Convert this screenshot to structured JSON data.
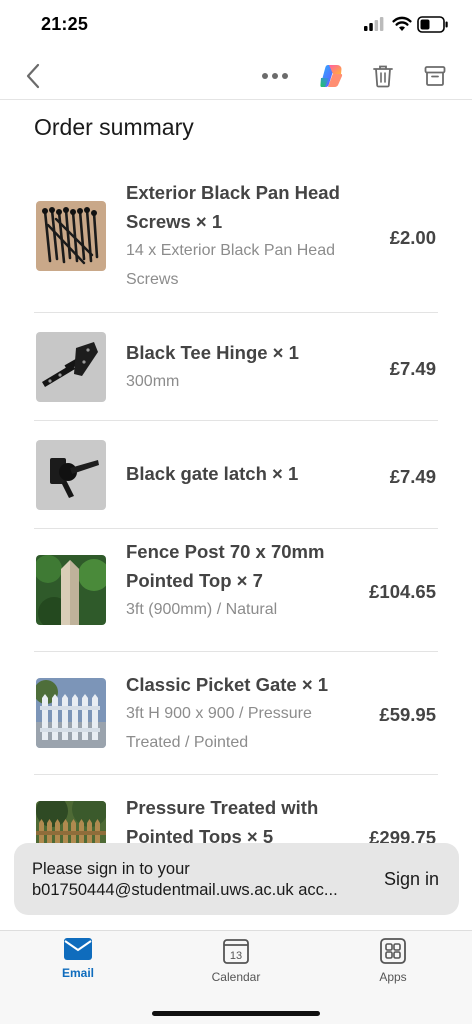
{
  "status_bar": {
    "time": "21:25"
  },
  "nav": {
    "icons": [
      "chevron-left-icon",
      "more-horizontal-icon",
      "copilot-icon",
      "trash-icon",
      "archive-icon"
    ]
  },
  "summary": {
    "title": "Order summary",
    "items": [
      {
        "name": "Exterior Black Pan Head Screws × 1",
        "desc": "14 x Exterior Black Pan Head Screws",
        "price": "£2.00",
        "thumb": "screws"
      },
      {
        "name": "Black Tee Hinge × 1",
        "desc": "300mm",
        "price": "£7.49",
        "thumb": "hinge"
      },
      {
        "name": "Black gate latch × 1",
        "desc": "",
        "price": "£7.49",
        "thumb": "latch"
      },
      {
        "name": "Fence Post 70 x 70mm Pointed Top × 7",
        "desc": "3ft (900mm) / Natural",
        "price": "£104.65",
        "thumb": "post"
      },
      {
        "name": "Classic Picket Gate × 1",
        "desc": "3ft H 900 x 900 / Pressure Treated / Pointed",
        "price": "£59.95",
        "thumb": "gate"
      },
      {
        "name": "Pressure Treated with Pointed Tops × 5",
        "desc": "",
        "price": "£299.75",
        "thumb": "fence"
      }
    ]
  },
  "signin_banner": {
    "message_line1": "Please sign in to your",
    "message_line2": "b01750444@studentmail.uws.ac.uk acc...",
    "button": "Sign in"
  },
  "tabs": [
    {
      "label": "Email",
      "icon": "mail-icon",
      "active": true
    },
    {
      "label": "Calendar",
      "icon": "calendar-icon",
      "day": "13"
    },
    {
      "label": "Apps",
      "icon": "apps-grid-icon"
    }
  ],
  "colors": {
    "accent": "#0f6cbd",
    "banner_bg": "#e6e6e6",
    "price_text": "#444444"
  }
}
